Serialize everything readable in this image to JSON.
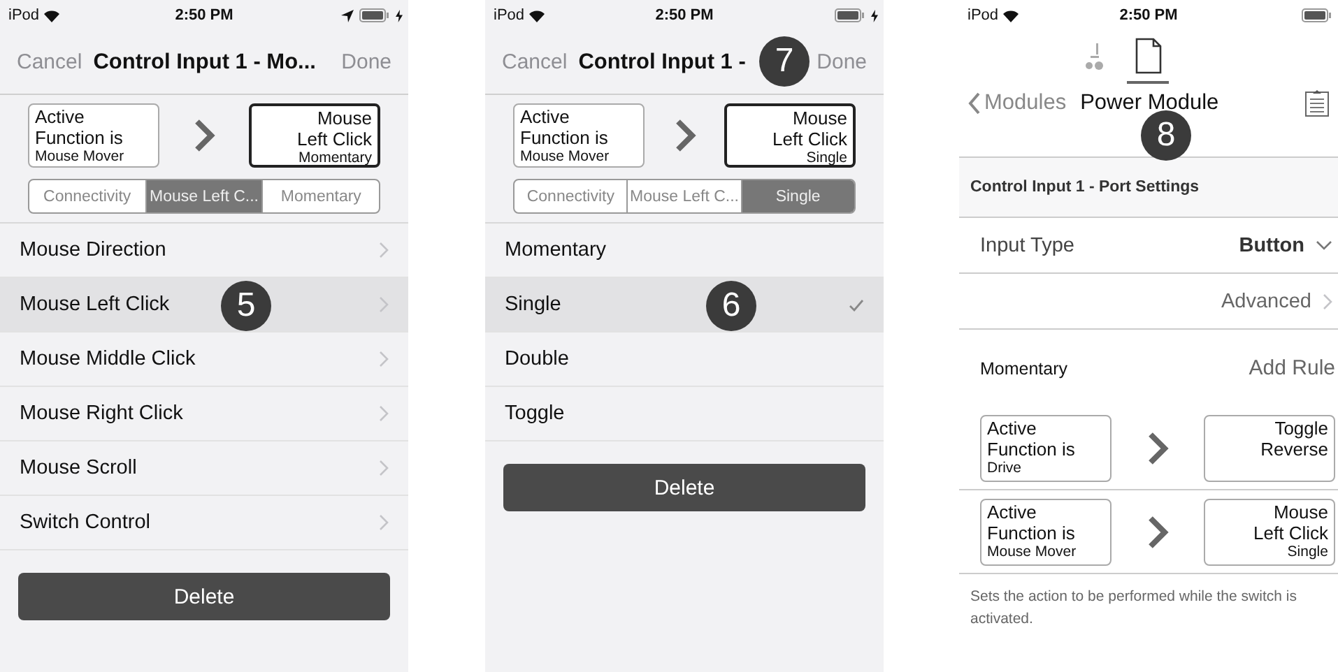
{
  "screens": [
    {
      "kind": "editor",
      "status": {
        "carrier": "iPod",
        "time": "2:50 PM",
        "location": true,
        "charging": true
      },
      "nav": {
        "cancel": "Cancel",
        "title": "Control Input 1 - Mo...",
        "done": "Done"
      },
      "rule": {
        "condition_lines": [
          "Active",
          "Function is"
        ],
        "condition_value": "Mouse Mover",
        "action_lines": [
          "Mouse",
          "Left Click"
        ],
        "action_detail": "Momentary",
        "highlighted": true
      },
      "segments": [
        {
          "label": "Connectivity",
          "selected": false
        },
        {
          "label": "Mouse Left C...",
          "selected": true
        },
        {
          "label": "Momentary",
          "selected": false
        }
      ],
      "list": [
        {
          "label": "Mouse Direction",
          "selected": false,
          "kind": "chevron"
        },
        {
          "label": "Mouse Left Click",
          "selected": true,
          "kind": "chevron",
          "badge": "5"
        },
        {
          "label": "Mouse Middle Click",
          "selected": false,
          "kind": "chevron"
        },
        {
          "label": "Mouse Right Click",
          "selected": false,
          "kind": "chevron"
        },
        {
          "label": "Mouse Scroll",
          "selected": false,
          "kind": "chevron"
        },
        {
          "label": "Switch Control",
          "selected": false,
          "kind": "chevron"
        }
      ],
      "delete": "Delete"
    },
    {
      "kind": "editor",
      "status": {
        "carrier": "iPod",
        "time": "2:50 PM",
        "location": false,
        "charging": true
      },
      "nav": {
        "cancel": "Cancel",
        "title": "Control Input 1 -",
        "done": "Done",
        "badge": "7"
      },
      "rule": {
        "condition_lines": [
          "Active",
          "Function is"
        ],
        "condition_value": "Mouse Mover",
        "action_lines": [
          "Mouse",
          "Left Click"
        ],
        "action_detail": "Single",
        "highlighted": true
      },
      "segments": [
        {
          "label": "Connectivity",
          "selected": false
        },
        {
          "label": "Mouse Left C...",
          "selected": false
        },
        {
          "label": "Single",
          "selected": true
        }
      ],
      "list": [
        {
          "label": "Momentary",
          "selected": false,
          "kind": "option"
        },
        {
          "label": "Single",
          "selected": true,
          "kind": "option",
          "badge": "6"
        },
        {
          "label": "Double",
          "selected": false,
          "kind": "option"
        },
        {
          "label": "Toggle",
          "selected": false,
          "kind": "option"
        }
      ],
      "delete": "Delete"
    },
    {
      "kind": "module",
      "status": {
        "carrier": "iPod",
        "time": "2:50 PM",
        "location": false,
        "charging": false
      },
      "tabs": [
        {
          "kind": "chair",
          "selected": false
        },
        {
          "kind": "document",
          "selected": true
        }
      ],
      "nav": {
        "back": "Modules",
        "title": "Power Module",
        "badge": "8"
      },
      "section": "Control Input 1 - Port Settings",
      "settings": [
        {
          "kind": "select",
          "label": "Input Type",
          "value": "Button"
        },
        {
          "kind": "link",
          "value": "Advanced"
        }
      ],
      "rules_header": {
        "label": "Momentary",
        "action": "Add Rule"
      },
      "rules": [
        {
          "condition_lines": [
            "Active",
            "Function is"
          ],
          "condition_value": "Drive",
          "action_lines": [
            "Toggle",
            "Reverse"
          ],
          "highlighted": false
        },
        {
          "condition_lines": [
            "Active",
            "Function is"
          ],
          "condition_value": "Mouse Mover",
          "action_lines": [
            "Mouse",
            "Left Click"
          ],
          "action_detail": "Single",
          "highlighted": false
        }
      ],
      "footer": "Sets the action to be performed while the switch is activated."
    }
  ]
}
